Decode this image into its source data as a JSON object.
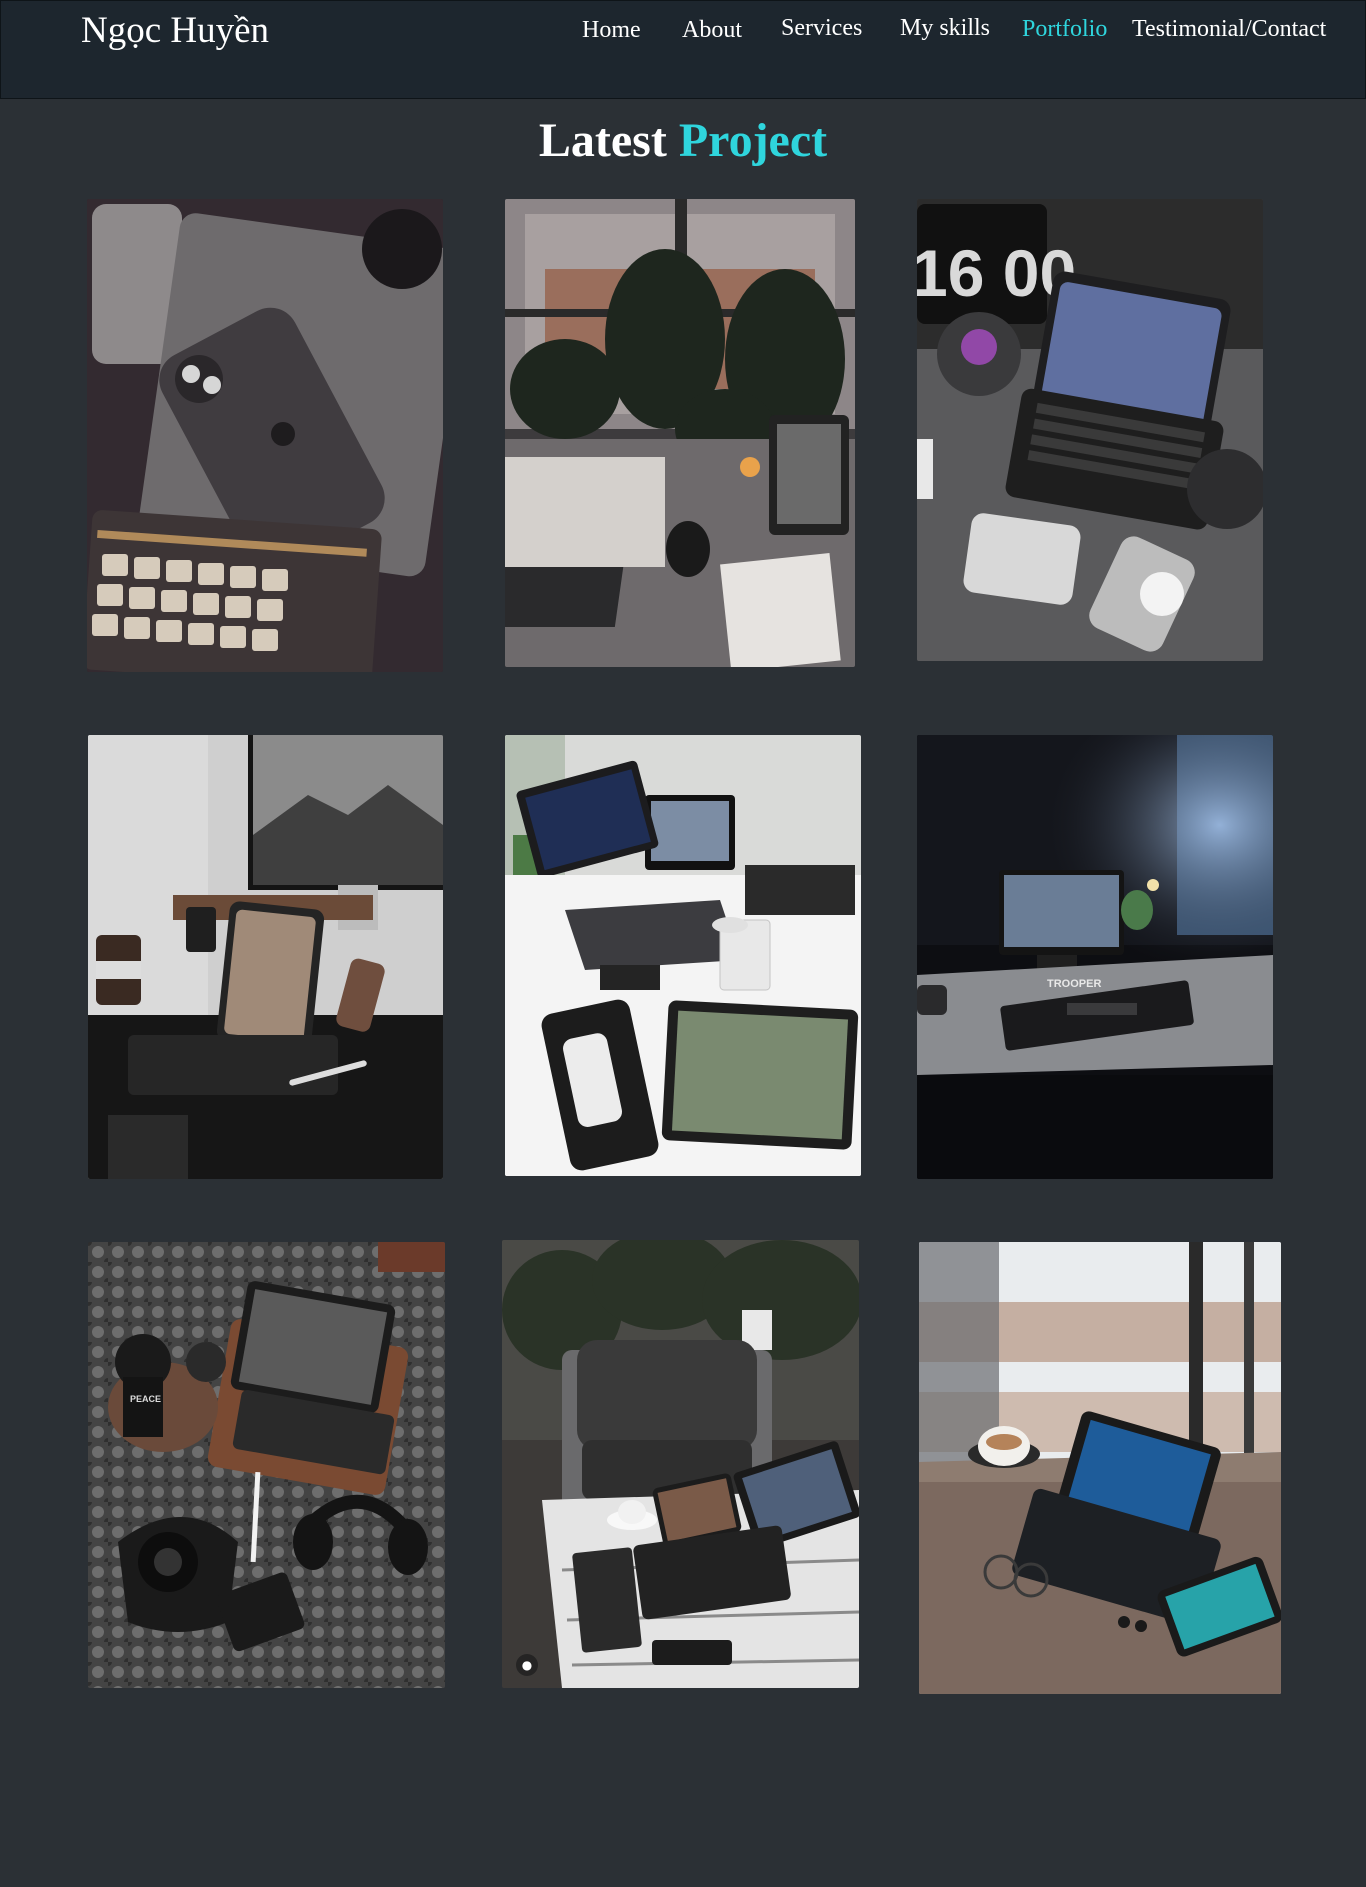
{
  "header": {
    "logo": "Ngọc Huyền",
    "nav": [
      {
        "label": "Home",
        "active": false
      },
      {
        "label": "About",
        "active": false
      },
      {
        "label": "Services",
        "active": false
      },
      {
        "label": "My skills",
        "active": false
      },
      {
        "label": "Portfolio",
        "active": true
      },
      {
        "label": "Testimonial/Contact",
        "active": false
      }
    ]
  },
  "portfolio": {
    "title_plain": "Latest",
    "title_accent": "Project",
    "clock_text": "16 00",
    "mat_text": "TROOPER",
    "mug_text": "PEACE"
  },
  "colors": {
    "background": "#2b3035",
    "header": "#1d262e",
    "accent": "#2fd5dd"
  }
}
